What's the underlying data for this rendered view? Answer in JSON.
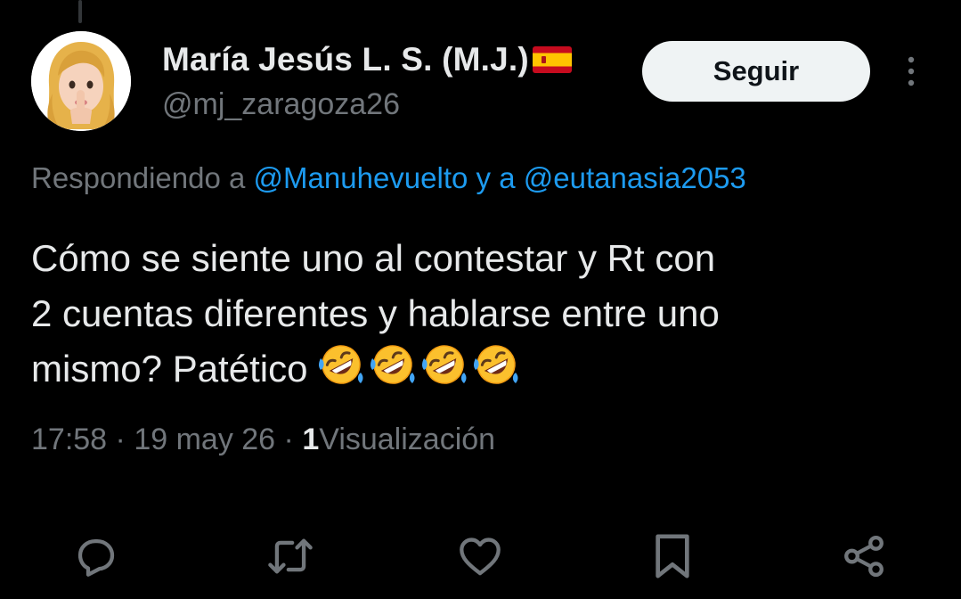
{
  "tweet": {
    "author": {
      "display_name": "María Jesús L. S. (M.J.)",
      "handle": "@mj_zaragoza26",
      "avatar_icon": "memoji-avatar-icon",
      "flag_icon": "spain-flag-icon"
    },
    "follow_label": "Seguir",
    "more_icon": "more-vertical-icon",
    "replying": {
      "prefix": "Respondiendo a",
      "mention_1": "@Manuhevuelto",
      "connector": "y a",
      "mention_2": "@eutanasia2053"
    },
    "text": {
      "line_1": "Cómo se siente uno al contestar y Rt con",
      "line_2": "2 cuentas diferentes y hablarse entre uno",
      "line_3": "mismo? Patético",
      "emoji_icon": "rolling-on-floor-laughing-icon",
      "emoji_count": 4
    },
    "meta": {
      "time": "17:58",
      "date": "19 may 26",
      "views_count": "1",
      "views_label": "Visualización",
      "separator": "·"
    },
    "actions": [
      {
        "icon": "reply-icon"
      },
      {
        "icon": "retweet-icon"
      },
      {
        "icon": "like-icon"
      },
      {
        "icon": "bookmark-icon"
      },
      {
        "icon": "share-icon"
      }
    ]
  },
  "colors": {
    "background": "#000000",
    "primary_text": "#e7e9ea",
    "secondary_text": "#71767b",
    "link": "#1d9bf0",
    "button_bg": "#eff3f4",
    "button_text": "#0f1419"
  }
}
